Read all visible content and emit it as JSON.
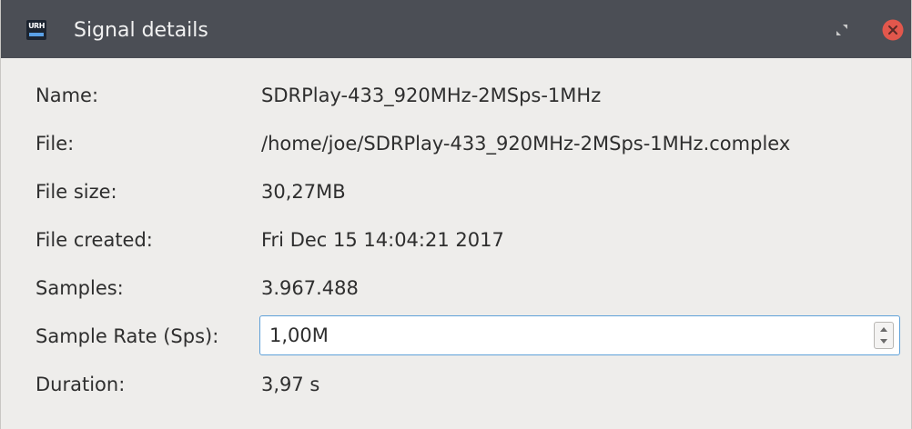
{
  "window": {
    "title": "Signal details",
    "app_icon": "urh-logo-icon",
    "app_icon_text": "URH"
  },
  "fields": {
    "name": {
      "label": "Name:",
      "value": "SDRPlay-433_920MHz-2MSps-1MHz"
    },
    "file": {
      "label": "File:",
      "value": "/home/joe/SDRPlay-433_920MHz-2MSps-1MHz.complex"
    },
    "file_size": {
      "label": "File size:",
      "value": "30,27MB"
    },
    "file_created": {
      "label": "File created:",
      "value": "Fri Dec 15 14:04:21 2017"
    },
    "samples": {
      "label": "Samples:",
      "value": "3.967.488"
    },
    "sample_rate": {
      "label": "Sample Rate (Sps):",
      "value": "1,00M"
    },
    "duration": {
      "label": "Duration:",
      "value": "3,97 s"
    }
  },
  "colors": {
    "titlebar": "#4b4e55",
    "background": "#eeedeb",
    "close_button": "#e2574c",
    "focus_border": "#5ea0d8"
  }
}
